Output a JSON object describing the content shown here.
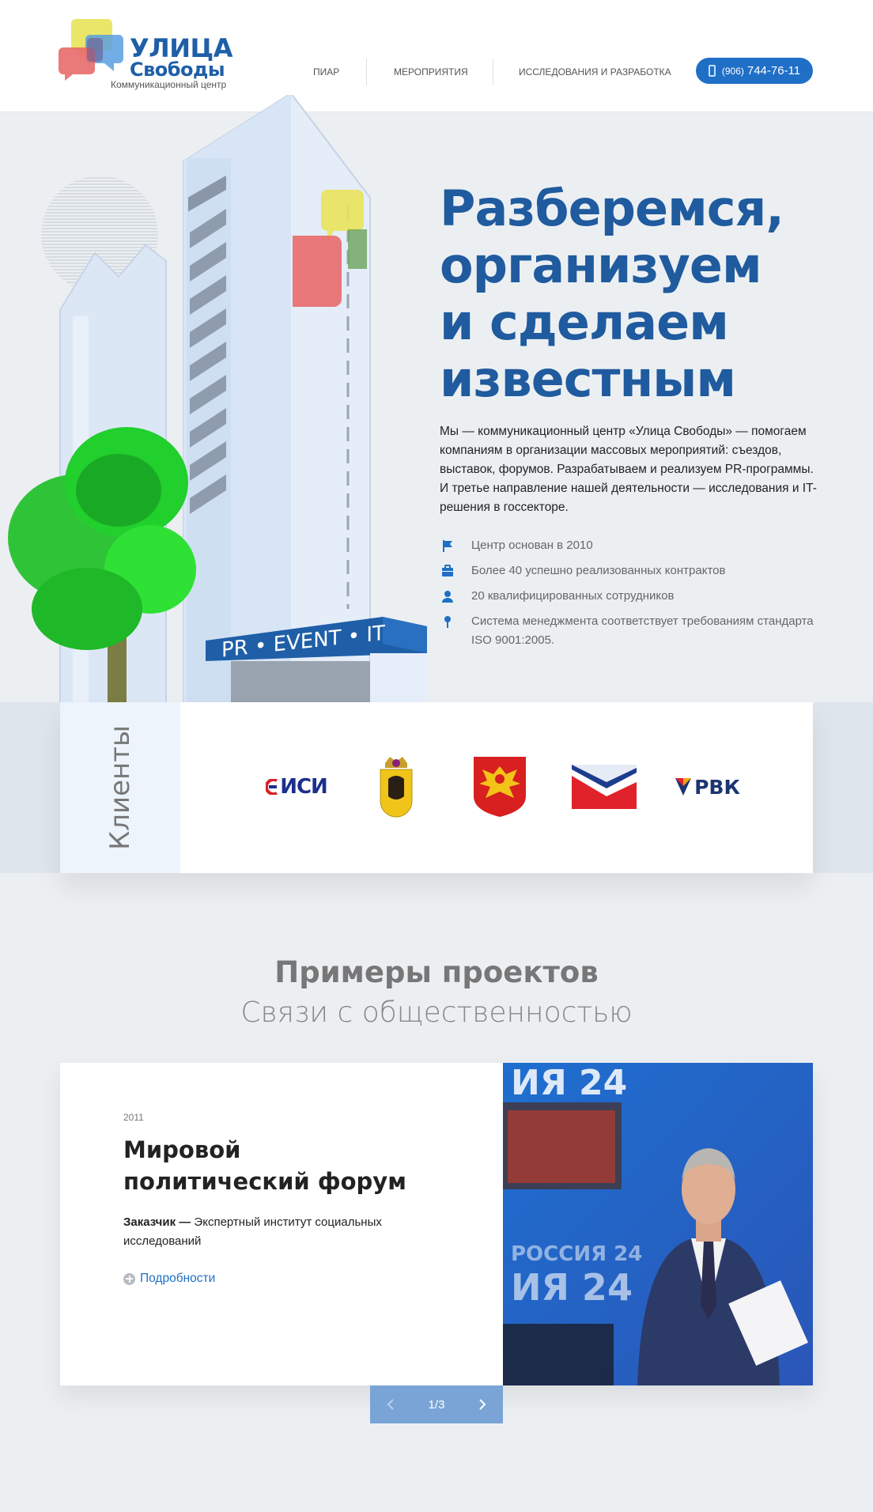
{
  "logo": {
    "title_line1": "УЛИЦА",
    "title_line2": "Свободы",
    "subtitle": "Коммуникационный центр"
  },
  "nav": {
    "items": [
      {
        "label": "Пиар"
      },
      {
        "label": "Мероприятия"
      },
      {
        "label": "Исследования и разработка"
      }
    ],
    "phone": {
      "code": "(906)",
      "number": "744-76-11"
    }
  },
  "hero": {
    "title_lines": [
      "Разберемся,",
      "организуем",
      "и сделаем",
      "известным"
    ],
    "description": "Мы — коммуникационный центр «Улица Свободы» — помогаем компаниям в организации массовых мероприятий: съездов, выставок, форумов. Разрабатываем и реализуем PR-программы. И третье направление нашей деятельности — исследования и IT-решения в госсекторе.",
    "building_sign": "PR • EVENT • IT",
    "facts": [
      {
        "icon": "flag-icon",
        "text": "Центр основан в 2010"
      },
      {
        "icon": "briefcase-icon",
        "text": "Более 40 успешно реализованных контрактов"
      },
      {
        "icon": "person-icon",
        "text": "20 квалифицированных сотрудников"
      },
      {
        "icon": "pin-icon",
        "text": "Система менеджмента соответствует требованиям стандарта ISO 9001:2005."
      }
    ]
  },
  "clients": {
    "label": "Клиенты",
    "logos": [
      {
        "name": "isi-logo",
        "text": "ИСИ"
      },
      {
        "name": "yaroslavl-coat-of-arms",
        "text": ""
      },
      {
        "name": "komi-coat-of-arms",
        "text": ""
      },
      {
        "name": "flag-logo",
        "text": ""
      },
      {
        "name": "rvk-logo",
        "text": "РВК"
      }
    ]
  },
  "projects": {
    "title": "Примеры проектов",
    "subtitle": "Связи с общественностью",
    "current": {
      "year": "2011",
      "name_lines": [
        "Мировой",
        "политический форум"
      ],
      "client_label": "Заказчик —",
      "client_name": " Экспертный институт социальных исследований",
      "more_label": "Подробности"
    },
    "pager": {
      "text": "1/3"
    }
  },
  "colors": {
    "brand_blue": "#1f5b9e",
    "accent_blue": "#1f6fc6",
    "pager_blue": "#7aa4d6",
    "background": "#eceff2"
  }
}
